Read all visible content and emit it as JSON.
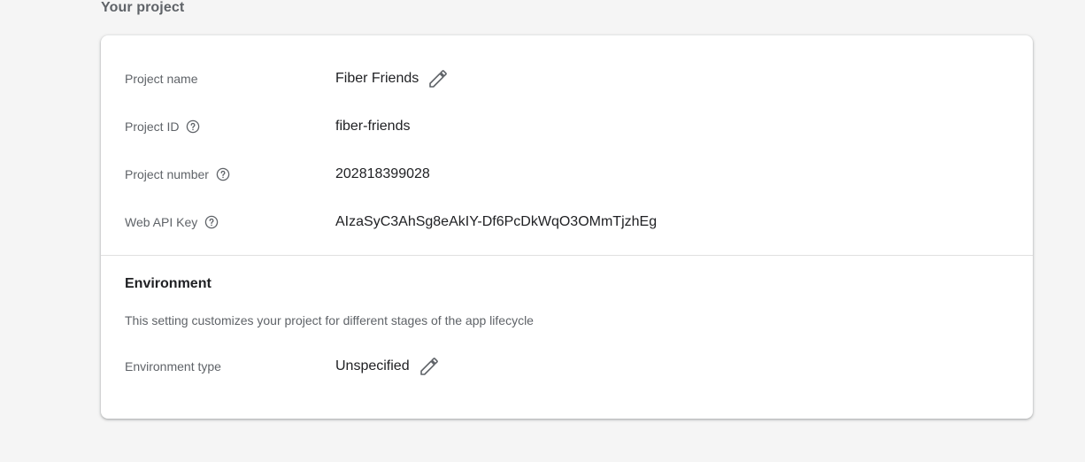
{
  "section": {
    "heading": "Your project"
  },
  "project": {
    "rows": [
      {
        "label": "Project name",
        "value": "Fiber Friends"
      },
      {
        "label": "Project ID",
        "value": "fiber-friends"
      },
      {
        "label": "Project number",
        "value": "202818399028"
      },
      {
        "label": "Web API Key",
        "value": "AIzaSyC3AhSg8eAkIY-Df6PcDkWqO3OMmTjzhEg"
      }
    ]
  },
  "environment": {
    "title": "Environment",
    "description": "This setting customizes your project for different stages of the app lifecycle",
    "type_label": "Environment type",
    "type_value": "Unspecified"
  },
  "icons": {
    "edit": "pencil-icon",
    "help": "help-circle-icon"
  },
  "colors": {
    "background": "#f5f5f5",
    "card": "#ffffff",
    "label_text": "#5f6368",
    "value_text": "#202124",
    "divider": "#e0e0e0"
  }
}
